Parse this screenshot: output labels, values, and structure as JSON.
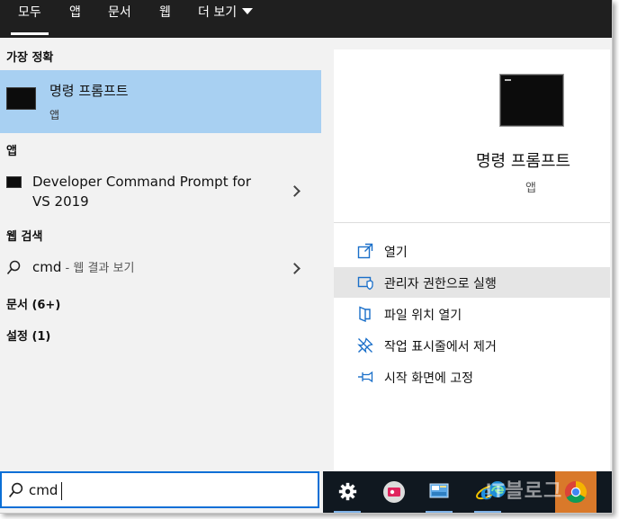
{
  "tabs": [
    {
      "label": "모두"
    },
    {
      "label": "앱"
    },
    {
      "label": "문서"
    },
    {
      "label": "웹"
    },
    {
      "label": "더 보기"
    }
  ],
  "left": {
    "best_match_heading": "가장 정확",
    "best_match": {
      "title": "명령 프롬프트",
      "subtitle": "앱",
      "icon": "terminal-icon"
    },
    "apps_heading": "앱",
    "apps": [
      {
        "title_line1": "Developer Command Prompt for",
        "title_line2": "VS 2019",
        "icon": "terminal-icon"
      }
    ],
    "web_heading": "웹 검색",
    "web_result": {
      "query": "cmd",
      "suffix": " - 웹 결과 보기",
      "icon": "search-icon"
    },
    "documents_heading": "문서 (6+)",
    "settings_heading": "설정 (1)"
  },
  "detail": {
    "app_name": "명령 프롬프트",
    "app_kind": "앱",
    "actions": [
      {
        "label": "열기",
        "icon": "open-icon"
      },
      {
        "label": "관리자 권한으로 실행",
        "icon": "shield-icon"
      },
      {
        "label": "파일 위치 열기",
        "icon": "file-location-icon"
      },
      {
        "label": "작업 표시줄에서 제거",
        "icon": "unpin-taskbar-icon"
      },
      {
        "label": "시작 화면에 고정",
        "icon": "pin-start-icon"
      }
    ]
  },
  "search": {
    "value": "cmd"
  },
  "taskbar": {
    "items": [
      "settings-gear-icon",
      "media-app-icon",
      "control-panel-icon",
      "internet-explorer-icon",
      "chrome-icon"
    ],
    "watermark": "IT블로그"
  },
  "colors": {
    "accent": "#0a6fd6",
    "selection": "#a8d0f2",
    "tabbar": "#1f1f1f",
    "taskbar": "#101820"
  }
}
